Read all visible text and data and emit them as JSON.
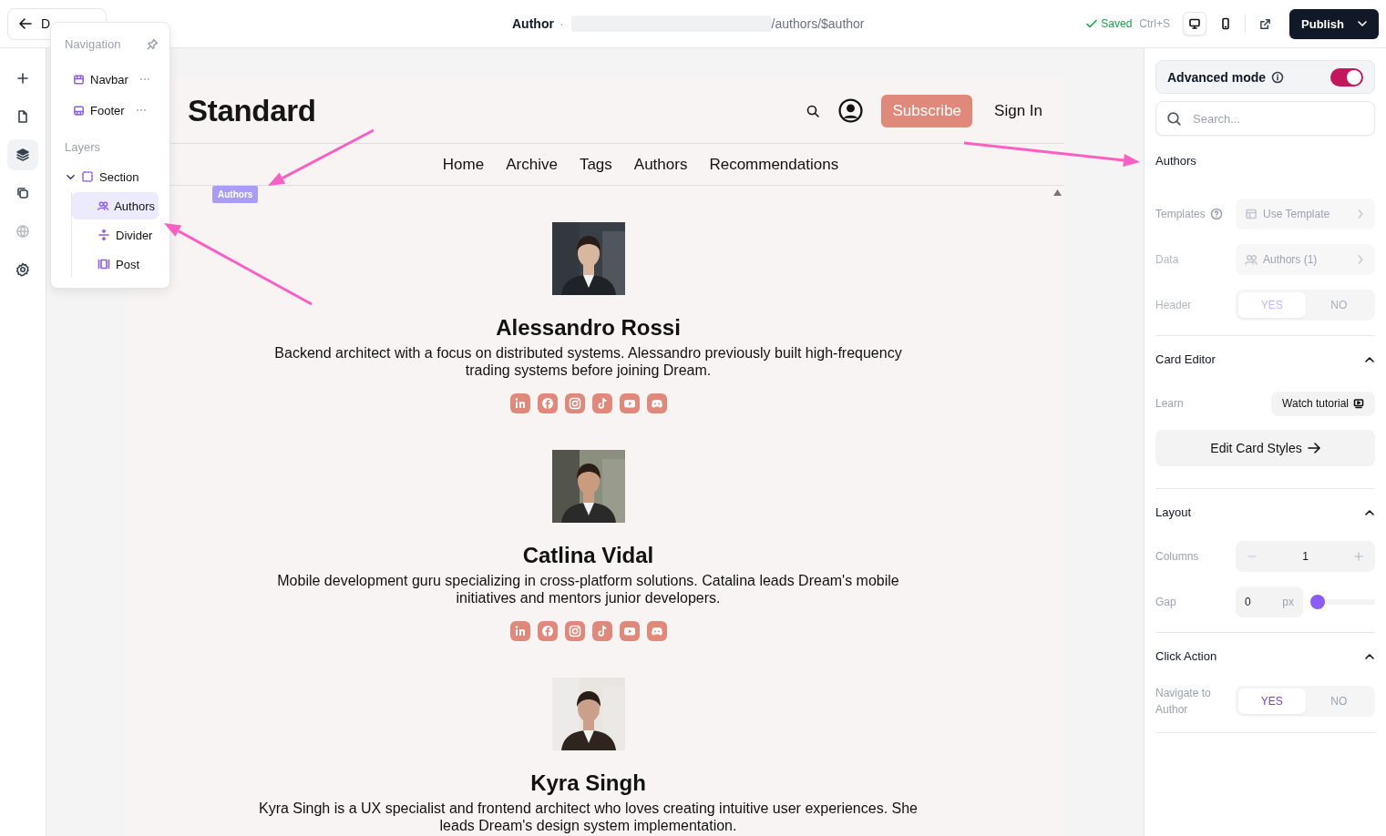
{
  "topbar": {
    "back_button": {
      "label": "D"
    },
    "page_title": "Author",
    "separator": "·",
    "path": "/authors/$author",
    "save_status": "Saved",
    "shortcut": "Ctrl+S",
    "devices": [
      {
        "kind": "desktop",
        "selected": true
      },
      {
        "kind": "mobile",
        "selected": false
      }
    ],
    "publish_button": "Publish"
  },
  "rail": [
    {
      "kind": "add",
      "selected": false,
      "disabled": false
    },
    {
      "kind": "page",
      "selected": false,
      "disabled": false
    },
    {
      "kind": "layers",
      "selected": true,
      "disabled": false
    },
    {
      "kind": "copy",
      "selected": false,
      "disabled": false
    },
    {
      "kind": "globe",
      "selected": false,
      "disabled": true
    },
    {
      "kind": "settings",
      "selected": false,
      "disabled": false
    }
  ],
  "layers_popup": {
    "navigation_title": "Navigation",
    "navigation_items": [
      {
        "kind": "navbar",
        "label": "Navbar"
      },
      {
        "kind": "footer",
        "label": "Footer"
      }
    ],
    "layers_title": "Layers",
    "tree": [
      {
        "kind": "section",
        "label": "Section",
        "expanded": true,
        "selected": false,
        "children": [
          {
            "kind": "authors",
            "label": "Authors",
            "selected": true
          },
          {
            "kind": "divider",
            "label": "Divider",
            "selected": false
          },
          {
            "kind": "post",
            "label": "Post",
            "selected": false
          }
        ]
      }
    ]
  },
  "site": {
    "logo": "Standard",
    "subscribe_button": "Subscribe",
    "sign_in": "Sign In",
    "nav": [
      "Home",
      "Archive",
      "Tags",
      "Authors",
      "Recommendations"
    ],
    "selection_badge": "Authors",
    "authors": [
      {
        "name": "Alessandro Rossi",
        "bio": "Backend architect with a focus on distributed systems. Alessandro previously built high-frequency trading systems before joining Dream.",
        "socials": [
          {
            "kind": "linkedin"
          },
          {
            "kind": "facebook"
          },
          {
            "kind": "instagram"
          },
          {
            "kind": "tiktok"
          },
          {
            "kind": "youtube"
          },
          {
            "kind": "discord"
          }
        ]
      },
      {
        "name": "Catlina Vidal",
        "bio": "Mobile development guru specializing in cross-platform solutions. Catalina leads Dream's mobile initiatives and mentors junior developers.",
        "socials": [
          {
            "kind": "linkedin"
          },
          {
            "kind": "facebook"
          },
          {
            "kind": "instagram"
          },
          {
            "kind": "tiktok"
          },
          {
            "kind": "youtube"
          },
          {
            "kind": "discord"
          }
        ]
      },
      {
        "name": "Kyra Singh",
        "bio": "Kyra Singh is a UX specialist and frontend architect who loves creating intuitive user experiences. She leads Dream's design system implementation."
      }
    ]
  },
  "panel": {
    "advanced_mode": {
      "label": "Advanced mode",
      "on": true
    },
    "search": {
      "placeholder": "Search..."
    },
    "section_title": "Authors",
    "rows": [
      {
        "kind": "template",
        "label": "Templates",
        "help": true,
        "disabled": false,
        "value": "Use Template"
      },
      {
        "kind": "data",
        "label": "Data",
        "help": false,
        "disabled": true,
        "value": "Authors (1)"
      },
      {
        "kind": "toggle",
        "label": "Header",
        "disabled": true,
        "options": [
          {
            "label": "YES",
            "selected": true
          },
          {
            "label": "NO",
            "selected": false
          }
        ]
      }
    ],
    "sections": [
      {
        "title": "Card Editor",
        "expanded": true,
        "rows": [
          {
            "kind": "tutorial",
            "label": "Learn",
            "value": "Watch tutorial"
          },
          {
            "kind": "wide_button",
            "value": "Edit Card Styles"
          }
        ]
      },
      {
        "title": "Layout",
        "expanded": true,
        "rows": [
          {
            "kind": "stepper",
            "label": "Columns",
            "value": "1"
          },
          {
            "kind": "gap",
            "label": "Gap",
            "value": "0",
            "unit": "px",
            "level": 0
          }
        ]
      },
      {
        "title": "Click Action",
        "expanded": true,
        "rows": [
          {
            "kind": "toggle",
            "label": "Navigate to Author",
            "disabled": false,
            "options": [
              {
                "label": "YES",
                "selected": true
              },
              {
                "label": "NO",
                "selected": false
              }
            ]
          }
        ]
      }
    ]
  }
}
